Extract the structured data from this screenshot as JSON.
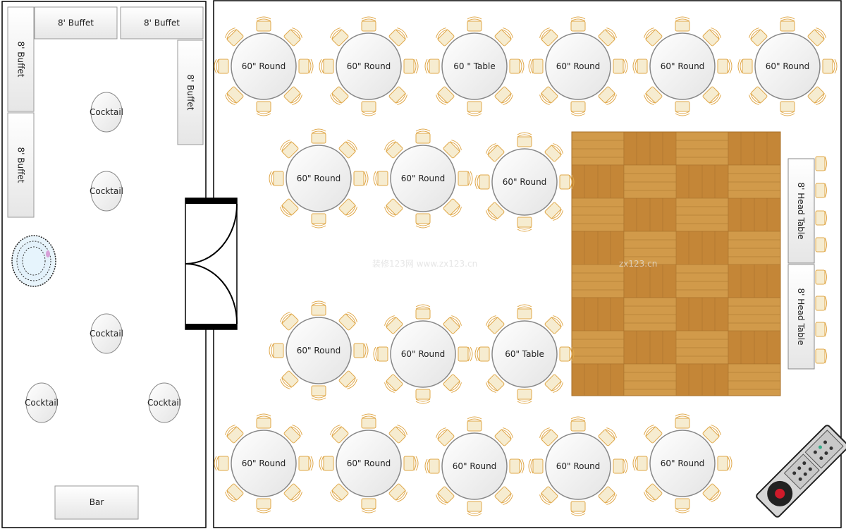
{
  "colors": {
    "chair_stroke": "#e0a84a",
    "chair_fill": "#f6ecd0",
    "table_fill": "#f2f2f2",
    "table_stroke": "#888888",
    "wall": "#000000",
    "wood": "#c98f3c"
  },
  "side_room": {
    "buffets": [
      "8' Buffet",
      "8' Buffet",
      "8' Buffet",
      "8' Buffet",
      "8' Buffet"
    ],
    "cocktails": [
      "Cocktail",
      "Cocktail",
      "Cocktail",
      "Cocktail",
      "Cocktail"
    ],
    "bar": "Bar",
    "cake_icon": "cake-icon"
  },
  "main_room": {
    "round_tables": [
      "60\" Round",
      "60\" Round",
      "60 \" Table",
      "60\" Round",
      "60\" Round",
      "60\" Round",
      "60\" Round",
      "60\" Round",
      "60\" Round",
      "60\" Round",
      "60\" Round",
      "60\" Table",
      "60\" Round",
      "60\" Round",
      "60\" Round",
      "60\" Round",
      "60\" Round"
    ],
    "head_tables": [
      "8' Head Table",
      "8' Head Table"
    ],
    "dance_floor_icon": "parquet-dance-floor",
    "dj_icon": "dj-console-icon"
  },
  "watermark": {
    "left": "装修123网  www.zx123.cn",
    "right": "zx123.cn"
  }
}
